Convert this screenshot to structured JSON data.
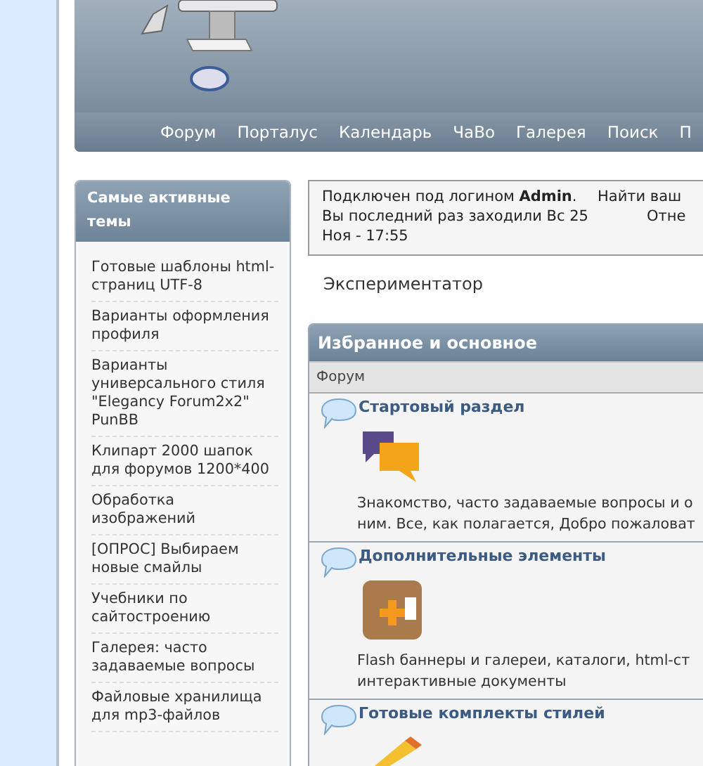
{
  "nav": [
    "Форум",
    "Порталус",
    "Календарь",
    "ЧаВо",
    "Галерея",
    "Поиск",
    "П"
  ],
  "sidebar": {
    "title": "Самые активные темы",
    "items": [
      "Готовые шаблоны html-страниц UTF-8",
      "Варианты оформления профиля",
      "Варианты универсального стиля \"Elegancy Forum2x2\" PunBB",
      "Клипарт 2000 шапок для форумов 1200*400",
      "Обработка изображений",
      "[ОПРОС] Выбираем новые смайлы",
      "Учебники по сайтостроению",
      "Галерея: часто задаваемые вопросы",
      "Файловые хранилища для mp3-файлов"
    ]
  },
  "login": {
    "text": "Подключен под логином **Admin**.",
    "last_visit": "Вы последний раз заходили Вс 25 Ноя - 17:55",
    "link_1": "Найти ваш",
    "link_2": "Отне"
  },
  "rank": "Экспериментатор",
  "category": {
    "title": "Избранное и основное",
    "column": "Форум",
    "forums": [
      {
        "title": "Стартовый раздел",
        "kind": "chat",
        "description": [
          "Знакомство, часто задаваемые вопросы и о",
          "ним. Все, как полагается, Добро пожаловат"
        ]
      },
      {
        "title": "Дополнительные элементы",
        "kind": "box",
        "description": [
          "Flash баннеры и галереи, каталоги, html-ст",
          "интерактивные документы"
        ]
      },
      {
        "title": "Готовые комплекты стилей",
        "kind": "pencil"
      }
    ]
  }
}
